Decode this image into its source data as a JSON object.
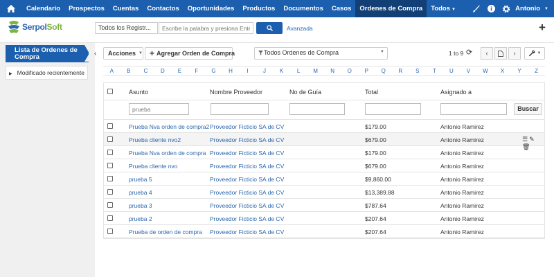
{
  "nav": {
    "items": [
      "Calendario",
      "Prospectos",
      "Cuentas",
      "Contactos",
      "Oportunidades",
      "Productos",
      "Documentos",
      "Casos",
      "Ordenes de Compra",
      "Todos"
    ],
    "active_index": 8,
    "user": "Antonio"
  },
  "brand": {
    "name_part1": "Serpol",
    "name_part2": "Soft"
  },
  "search": {
    "module": "Todos los Registr...",
    "placeholder": "Escribe la palabra y presiona Enter",
    "advanced": "Avanzada"
  },
  "sidebar": {
    "title": "Lista de Ordenes de Compra",
    "recent": "Modificado recientemente"
  },
  "toolbar": {
    "actions": "Acciones",
    "add": "Agregar Orden de Compra",
    "filter": "Todos Ordenes de Compra",
    "pager": "1 to 9"
  },
  "alphabet": [
    "A",
    "B",
    "C",
    "D",
    "E",
    "F",
    "G",
    "H",
    "I",
    "J",
    "K",
    "L",
    "M",
    "N",
    "O",
    "P",
    "Q",
    "R",
    "S",
    "T",
    "U",
    "V",
    "W",
    "X",
    "Y",
    "Z"
  ],
  "table": {
    "columns": {
      "subject": "Asunto",
      "vendor": "Nombre Proveedor",
      "guide": "No de Guía",
      "total": "Total",
      "assigned": "Asignado a"
    },
    "filter_subject_value": "prueba",
    "search_button": "Buscar",
    "rows": [
      {
        "subject": "Prueba Nva orden de compra2",
        "vendor": "Proveedor Ficticio SA de CV",
        "guide": "",
        "total": "$179.00",
        "assigned": "Antonio Ramirez"
      },
      {
        "subject": "Prueba cliente nvo2",
        "vendor": "Proveedor Ficticio SA de CV",
        "guide": "",
        "total": "$679.00",
        "assigned": "Antonio Ramirez"
      },
      {
        "subject": "Prueba Nva orden de compra",
        "vendor": "Proveedor Ficticio SA de CV",
        "guide": "",
        "total": "$179.00",
        "assigned": "Antonio Ramirez"
      },
      {
        "subject": "Prueba cliente nvo",
        "vendor": "Proveedor Ficticio SA de CV",
        "guide": "",
        "total": "$679.00",
        "assigned": "Antonio Ramirez"
      },
      {
        "subject": "prueba 5",
        "vendor": "Proveedor Ficticio SA de CV",
        "guide": "",
        "total": "$9,860.00",
        "assigned": "Antonio Ramirez"
      },
      {
        "subject": "prueba 4",
        "vendor": "Proveedor Ficticio SA de CV",
        "guide": "",
        "total": "$13,389.88",
        "assigned": "Antonio Ramirez"
      },
      {
        "subject": "prueba 3",
        "vendor": "Proveedor Ficticio SA de CV",
        "guide": "",
        "total": "$787.64",
        "assigned": "Antonio Ramirez"
      },
      {
        "subject": "prueba 2",
        "vendor": "Proveedor Ficticio SA de CV",
        "guide": "",
        "total": "$207.64",
        "assigned": "Antonio Ramirez"
      },
      {
        "subject": "Prueba de orden de compra",
        "vendor": "Proveedor Ficticio SA de CV",
        "guide": "",
        "total": "$207.64",
        "assigned": "Antonio Ramirez"
      }
    ],
    "hover_row_index": 1
  },
  "colors": {
    "primary": "#1b5fae",
    "active_nav": "#123f75",
    "link": "#2a66ad"
  },
  "icons": {
    "home": "home-icon",
    "brush": "paintbrush-icon",
    "info": "info-icon",
    "settings": "gear-icon",
    "search": "search-icon",
    "add": "plus-icon",
    "filter": "funnel-icon",
    "refresh": "refresh-icon",
    "wrench": "wrench-icon",
    "row_list": "list-icon",
    "row_edit": "pencil-icon",
    "row_delete": "trash-icon"
  }
}
